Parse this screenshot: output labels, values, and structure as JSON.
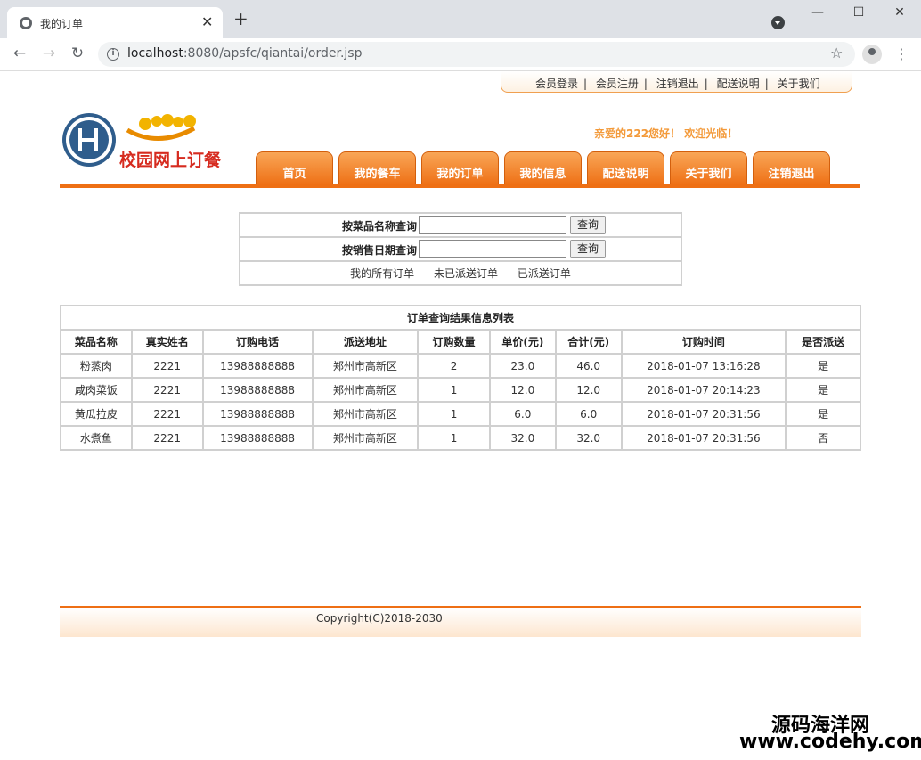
{
  "browser": {
    "tab_title": "我的订单",
    "url_host": "localhost",
    "url_rest": ":8080/apsfc/qiantai/order.jsp"
  },
  "toplinks": [
    "会员登录",
    "会员注册",
    "注销退出",
    "配送说明",
    "关于我们"
  ],
  "logo": {
    "text": "校园网上订餐",
    "accent": "#d62b1f"
  },
  "welcome": "亲爱的222您好！ 欢迎光临！",
  "nav": [
    "首页",
    "我的餐车",
    "我的订单",
    "我的信息",
    "配送说明",
    "关于我们",
    "注销退出"
  ],
  "search": {
    "by_name_label": "按菜品名称查询",
    "by_date_label": "按销售日期查询",
    "name_value": "",
    "date_value": "",
    "query_button": "查询",
    "filters": [
      "我的所有订单",
      "未已派送订单",
      "已派送订单"
    ]
  },
  "results": {
    "caption": "订单查询结果信息列表",
    "columns": [
      "菜品名称",
      "真实姓名",
      "订购电话",
      "派送地址",
      "订购数量",
      "单价(元)",
      "合计(元)",
      "订购时间",
      "是否派送"
    ],
    "rows": [
      [
        "粉蒸肉",
        "2221",
        "13988888888",
        "郑州市高新区",
        "2",
        "23.0",
        "46.0",
        "2018-01-07 13:16:28",
        "是"
      ],
      [
        "咸肉菜饭",
        "2221",
        "13988888888",
        "郑州市高新区",
        "1",
        "12.0",
        "12.0",
        "2018-01-07 20:14:23",
        "是"
      ],
      [
        "黄瓜拉皮",
        "2221",
        "13988888888",
        "郑州市高新区",
        "1",
        "6.0",
        "6.0",
        "2018-01-07 20:31:56",
        "是"
      ],
      [
        "水煮鱼",
        "2221",
        "13988888888",
        "郑州市高新区",
        "1",
        "32.0",
        "32.0",
        "2018-01-07 20:31:56",
        "否"
      ]
    ]
  },
  "footer": {
    "copyright": "Copyright(C)2018-2030"
  },
  "corner_watermark": {
    "site": "源码海洋网",
    "url": "www.codehy.com"
  },
  "colors": {
    "nav_orange": "#ee6f14",
    "welcome_orange": "#f39a3a"
  }
}
